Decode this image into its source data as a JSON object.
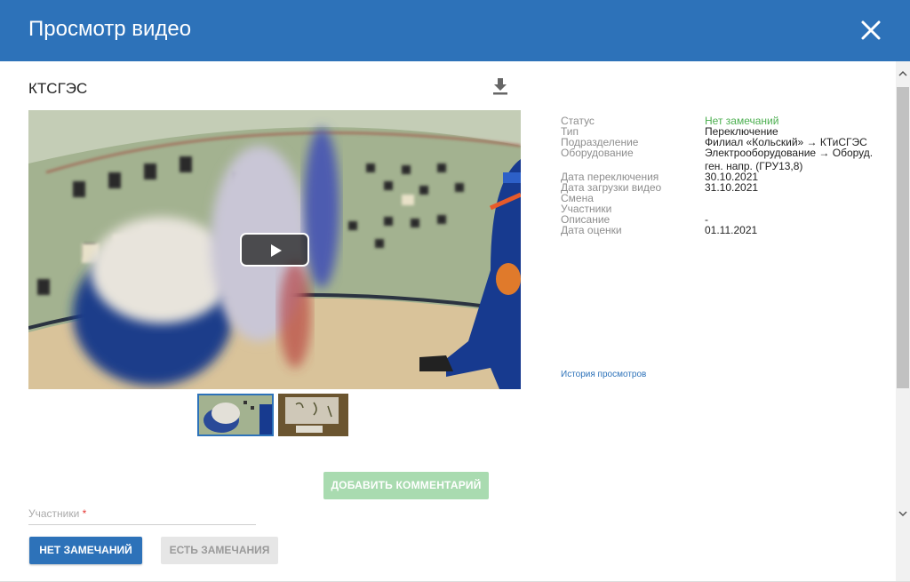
{
  "header": {
    "title": "Просмотр видео",
    "close_icon": "close-icon"
  },
  "video": {
    "title": "КТСГЭС",
    "download_icon": "download-icon",
    "play_icon": "play-icon"
  },
  "details": {
    "status_label": "Статус",
    "status_value": "Нет замечаний",
    "type_label": "Тип",
    "type_value": "Переключение",
    "division_label": "Подразделение",
    "division_value": "Филиал «Кольский» → КТиСГЭС",
    "equipment_label": "Оборудование",
    "equipment_value": "Электрооборудование → Оборуд. ген. напр. (ГРУ13,8)",
    "switch_date_label": "Дата переключения",
    "switch_date_value": "30.10.2021",
    "upload_date_label": "Дата загрузки видео",
    "upload_date_value": "31.10.2021",
    "shift_label": "Смена",
    "shift_value": "",
    "participants_label": "Участники",
    "participants_value": "",
    "description_label": "Описание",
    "description_value": "-",
    "rating_date_label": "Дата оценки",
    "rating_date_value": "01.11.2021",
    "history_link": "История просмотров"
  },
  "actions": {
    "add_comment": "ДОБАВИТЬ КОММЕНТАРИЙ",
    "participants_field_label": "Участники",
    "required_mark": "*",
    "no_issues": "НЕТ ЗАМЕЧАНИЙ",
    "has_issues": "ЕСТЬ ЗАМЕЧАНИЯ"
  },
  "colors": {
    "header": "#2d72b9",
    "status_ok": "#4caf50",
    "add_comment_bg": "#a9dbb0",
    "primary_button": "#2d72b9"
  }
}
